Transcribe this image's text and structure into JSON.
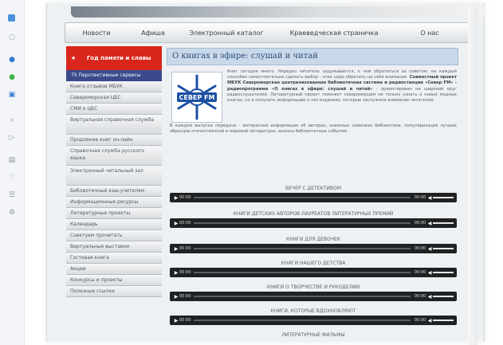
{
  "browser_strip": {
    "icons": [
      "grid-icon",
      "circle-icon",
      "dot-blue-icon",
      "dot-green-icon",
      "tab-icon",
      "search-icon",
      "arrow-icon",
      "panel-icon",
      "heart-icon",
      "list-icon",
      "settings-icon"
    ]
  },
  "topnav": {
    "items": [
      "Новости",
      "Афиша",
      "Электронный каталог",
      "Краеведческая страничка",
      "О нас"
    ]
  },
  "sidebar": {
    "head": "Год памяти и славы",
    "subhead": "75 Перспективные сервисы",
    "items": [
      "Книга отзывов МБУК",
      "Североморская ЦБС",
      "СМИ о ЦБС",
      "Виртуальная справочная служба",
      "Продление книг он-лайн",
      "Справочная служба русского языка",
      "Электронный читальный зал",
      "Библиотечный кэш-учителям",
      "Информационные ресурсы",
      "Литературные проекты",
      "Календарь",
      "Советуем прочитать",
      "Виртуальные выставки",
      "Гостевая книга",
      "Акции",
      "Конкурсы и проекты",
      "Полезные ссылки"
    ]
  },
  "content": {
    "title": "О книгах в эфире: слушай и читай",
    "logo_text": "СЕВЕР FM",
    "intro": "Книг сегодня много. Нередко читатель задумывается, о чем обратиться за советом: не каждый способен самостоятельно сделать выбор - этих надо обратить на себя внимание.",
    "intro_bold": "Совместный проект МБУК Североморская централизованная библиотечная система и радиостанции «Север FM» - радиопрограмма «О книгах в эфире: слушай и читай»",
    "intro_tail": "- ориентирован на широкий круг радиослушателей. Литературный проект поможет североморцам не только узнать о новых модных книгах, но и получить информацию о тех изданиях, которые заслужили внимание читателей.",
    "body": "В каждом выпуске передачи - интересная информация об авторах, книжных новинках библиотеки, популяризация лучших образцов отечественной и мировой литературы, анонсы библиотечных событий.",
    "tracks": [
      {
        "title": "ВЕЧЕР С ДЕТЕКТИВОМ",
        "time": "00:00",
        "duration": "00:00"
      },
      {
        "title": "КНИГИ ДЕТСКИХ АВТОРОВ-ЛАУРЕАТОВ ЛИТЕРАТУРНЫХ ПРЕМИЙ",
        "time": "00:00",
        "duration": "00:00"
      },
      {
        "title": "КНИГИ ДЛЯ ДЕВОЧЕК",
        "time": "00:00",
        "duration": "00:00"
      },
      {
        "title": "КНИГИ НАШЕГО ДЕТСТВА",
        "time": "00:00",
        "duration": "00:00"
      },
      {
        "title": "КНИГИ О ТВОРЧЕСТВЕ И РУКОДЕЛИИ",
        "time": "00:00",
        "duration": "00:00"
      },
      {
        "title": "КНИГИ, КОТОРЫЕ ВДОХНОВЛЯЮТ",
        "time": "00:00",
        "duration": "00:00"
      },
      {
        "title": "ЛИТЕРАТУРНЫЕ ФИЛЬМЫ",
        "time": "",
        "duration": ""
      }
    ]
  },
  "colors": {
    "sidebar_head": "#d9261c",
    "sidebar_sub": "#3b4a8c",
    "title_bg": "#c9d9ea",
    "player": "#1f2122"
  }
}
